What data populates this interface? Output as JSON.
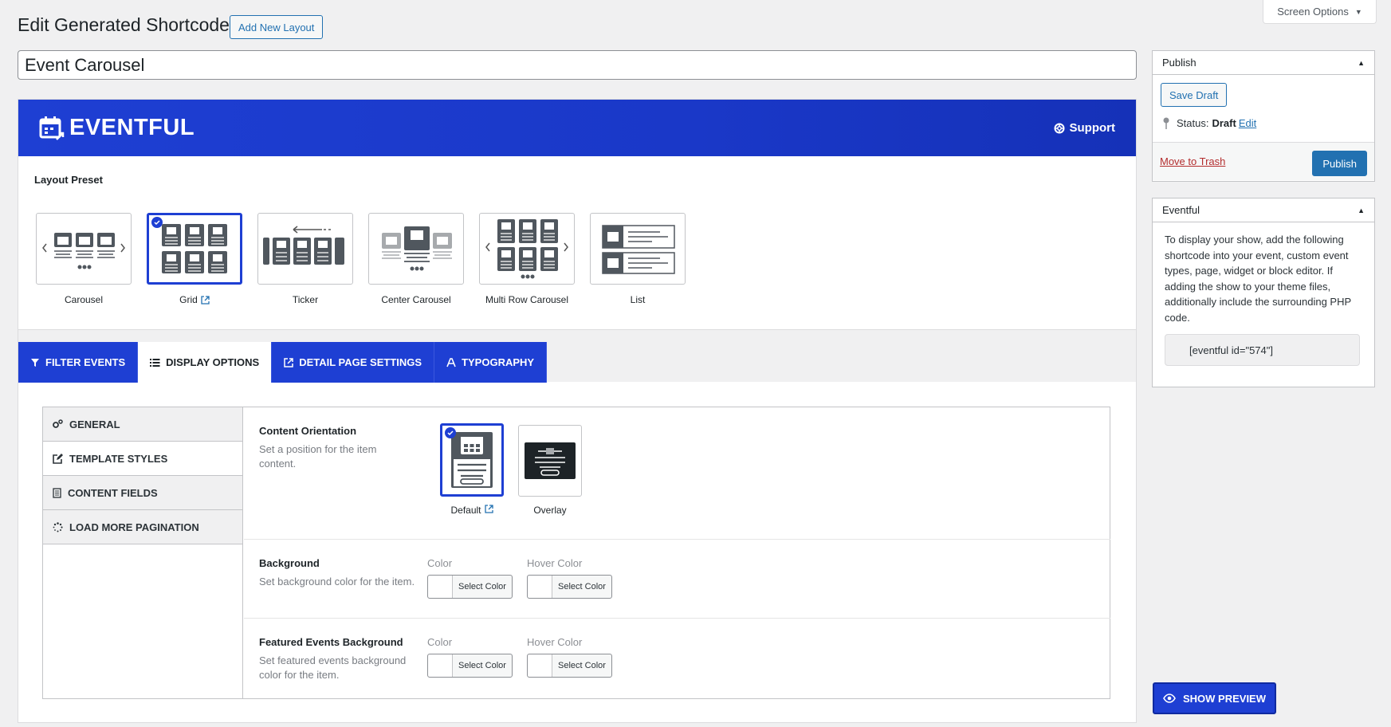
{
  "header": {
    "screen_options": "Screen Options",
    "page_title": "Edit Generated Shortcode",
    "add_new_label": "Add New Layout",
    "shortcode_title": "Event Carousel"
  },
  "banner": {
    "brand": "EVENTFUL",
    "support": "Support"
  },
  "layout_preset": {
    "label": "Layout Preset",
    "items": [
      {
        "name": "Carousel",
        "selected": false,
        "external": false
      },
      {
        "name": "Grid",
        "selected": true,
        "external": true
      },
      {
        "name": "Ticker",
        "selected": false,
        "external": false
      },
      {
        "name": "Center Carousel",
        "selected": false,
        "external": false
      },
      {
        "name": "Multi Row Carousel",
        "selected": false,
        "external": false
      },
      {
        "name": "List",
        "selected": false,
        "external": false
      }
    ]
  },
  "tabs": [
    {
      "label": "FILTER EVENTS",
      "icon": "filter-icon",
      "active": false
    },
    {
      "label": "DISPLAY OPTIONS",
      "icon": "list-icon",
      "active": true
    },
    {
      "label": "DETAIL PAGE SETTINGS",
      "icon": "external-link-icon",
      "active": false
    },
    {
      "label": "TYPOGRAPHY",
      "icon": "typography-icon",
      "active": false
    }
  ],
  "side_nav": [
    {
      "label": "GENERAL",
      "icon": "gears-icon",
      "active": false
    },
    {
      "label": "TEMPLATE STYLES",
      "icon": "edit-icon",
      "active": true
    },
    {
      "label": "CONTENT FIELDS",
      "icon": "document-icon",
      "active": false
    },
    {
      "label": "LOAD MORE PAGINATION",
      "icon": "spinner-icon",
      "active": false
    }
  ],
  "content_orientation": {
    "title": "Content Orientation",
    "description": "Set a position for the item content.",
    "options": [
      {
        "name": "Default",
        "selected": true
      },
      {
        "name": "Overlay",
        "selected": false
      }
    ]
  },
  "background": {
    "title": "Background",
    "description": "Set background color for the item.",
    "color_label": "Color",
    "hover_label": "Hover Color",
    "button": "Select Color"
  },
  "featured_background": {
    "title": "Featured Events Background",
    "description": "Set featured events background color for the item.",
    "color_label": "Color",
    "hover_label": "Hover Color",
    "button": "Select Color"
  },
  "publish_box": {
    "title": "Publish",
    "save_draft": "Save Draft",
    "status_label": "Status:",
    "status_value": "Draft",
    "edit_link": "Edit",
    "trash": "Move to Trash",
    "publish": "Publish"
  },
  "eventful_box": {
    "title": "Eventful",
    "text": "To display your show, add the following shortcode into your event, custom event types, page, widget or block editor. If adding the show to your theme files, additionally include the surrounding PHP code.",
    "shortcode": "[eventful id=\"574\"]"
  },
  "preview_button": "SHOW PREVIEW",
  "colors": {
    "brand_blue": "#1e3fd3",
    "wp_blue": "#2271b1",
    "trash_red": "#b32d2e"
  }
}
